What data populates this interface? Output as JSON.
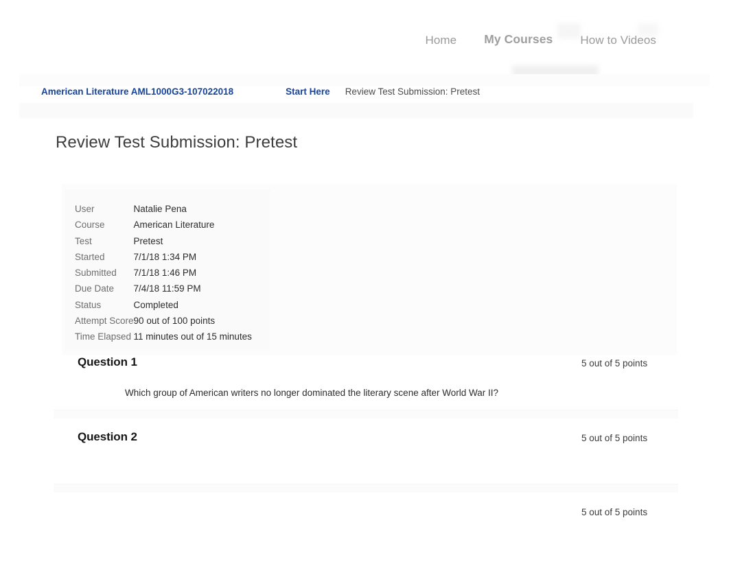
{
  "topnav": {
    "links": [
      {
        "label": "Home",
        "active": false
      },
      {
        "label": "My Courses",
        "active": true
      },
      {
        "label": "How to Videos",
        "active": false
      }
    ]
  },
  "breadcrumb": {
    "course": "American Literature AML1000G3-107022018",
    "section": "Start Here",
    "current": "Review Test Submission: Pretest"
  },
  "page": {
    "title": "Review Test Submission: Pretest"
  },
  "summary": {
    "rows": [
      {
        "label": "User",
        "value": "Natalie Pena"
      },
      {
        "label": "Course",
        "value": "American Literature"
      },
      {
        "label": "Test",
        "value": "Pretest"
      },
      {
        "label": "Started",
        "value": "7/1/18 1:34 PM"
      },
      {
        "label": "Submitted",
        "value": "7/1/18 1:46 PM"
      },
      {
        "label": "Due Date",
        "value": "7/4/18 11:59 PM"
      },
      {
        "label": "Status",
        "value": "Completed"
      },
      {
        "label": "Attempt Score",
        "value": "90 out of 100 points"
      },
      {
        "label": "Time Elapsed",
        "value": "11 minutes out of 15 minutes"
      }
    ]
  },
  "questions": [
    {
      "title": "Question 1",
      "points": "5 out of 5 points",
      "text": "Which group of American writers no longer dominated the literary scene after World War II?"
    },
    {
      "title": "Question 2",
      "points": "5 out of 5 points",
      "text": ""
    },
    {
      "title": "",
      "points": "5 out of 5 points",
      "text": ""
    }
  ],
  "colors": {
    "link_blue": "#16449b",
    "nav_gray": "#9a9a9a",
    "body_text": "#2b2b2b",
    "label_gray": "#6d6d6d",
    "panel_bg": "#fcfcfd"
  }
}
